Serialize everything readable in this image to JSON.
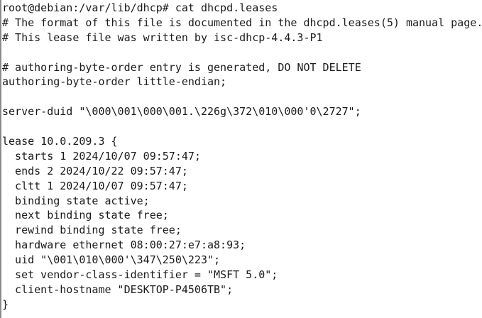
{
  "terminal": {
    "lines": [
      "root@debian:/var/lib/dhcp# cat dhcpd.leases",
      "# The format of this file is documented in the dhcpd.leases(5) manual page.",
      "# This lease file was written by isc-dhcp-4.4.3-P1",
      "",
      "# authoring-byte-order entry is generated, DO NOT DELETE",
      "authoring-byte-order little-endian;",
      "",
      "server-duid \"\\000\\001\\000\\001.\\226g\\372\\010\\000'0\\2727\";",
      "",
      "lease 10.0.209.3 {",
      "  starts 1 2024/10/07 09:57:47;",
      "  ends 2 2024/10/22 09:57:47;",
      "  cltt 1 2024/10/07 09:57:47;",
      "  binding state active;",
      "  next binding state free;",
      "  rewind binding state free;",
      "  hardware ethernet 08:00:27:e7:a8:93;",
      "  uid \"\\001\\010\\000'\\347\\250\\223\";",
      "  set vendor-class-identifier = \"MSFT 5.0\";",
      "  client-hostname \"DESKTOP-P4506TB\";",
      "}"
    ]
  }
}
